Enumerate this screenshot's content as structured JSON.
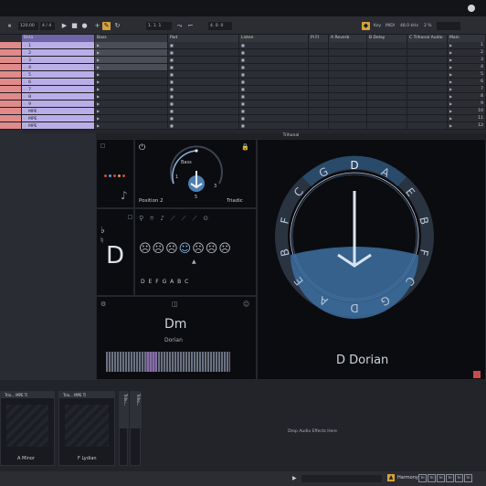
{
  "transport": {
    "tempo": "120.00",
    "signature": "4 / 4",
    "position": "1. 1. 1",
    "bars": "4. 0. 0",
    "key": "Key",
    "midi": "MIDI",
    "sample_rate": "48.0 kHz",
    "cpu": "2 %"
  },
  "tracks": [
    {
      "name": "Beta",
      "color": "#8a7bd0"
    },
    {
      "name": "Bass",
      "color": "#6e7a8c"
    },
    {
      "name": "Pad",
      "color": "#6e7a8c"
    },
    {
      "name": "Listen",
      "color": "#6e7a8c"
    },
    {
      "name": "Pi Fl",
      "color": "#6e7a8c"
    },
    {
      "name": "A Reverb",
      "color": "#6e7a8c"
    },
    {
      "name": "B Delay",
      "color": "#6e7a8c"
    },
    {
      "name": "C Trihonal Audio",
      "color": "#6e7a8c"
    },
    {
      "name": "Main",
      "color": "#6e7a8c"
    }
  ],
  "clips": [
    "1",
    "2",
    "3",
    "4",
    "5",
    "6",
    "7",
    "8",
    "9",
    "MPE",
    "MPE",
    "MPE"
  ],
  "scenes": [
    "1",
    "2",
    "3",
    "4",
    "5",
    "6",
    "7",
    "8",
    "9",
    "10",
    "11",
    "12"
  ],
  "plugin": {
    "title": "Trihonal",
    "position_label": "Position 2",
    "triadic_label": "Triadic",
    "chord_label": "Bass",
    "position_value": "5",
    "left_num": "1",
    "right_num": "3",
    "key_letter": "D",
    "scale_letters": "D E F G A B C",
    "chord": "Dm",
    "mode_small": "Dorian",
    "mode_big": "D Dorian",
    "ring_letters": [
      "D",
      "A",
      "E",
      "B",
      "F",
      "C",
      "G",
      "D",
      "A",
      "E",
      "B",
      "F",
      "C",
      "G"
    ]
  },
  "devices": {
    "dev1_title": "Trio... MPE Ti",
    "dev1_mode": "A Minor",
    "dev2_title": "Trio... MPE Ti",
    "dev2_mode": "F Lydian",
    "dev3_title": "Trihu...",
    "dev4_title": "Triho...",
    "drop_hint": "Drop Audio Effects Here"
  },
  "statusbar": {
    "label": "Harmony",
    "chips": [
      "Tri",
      "Tri",
      "Tri",
      "Tri",
      "Tri",
      "Tri"
    ]
  }
}
